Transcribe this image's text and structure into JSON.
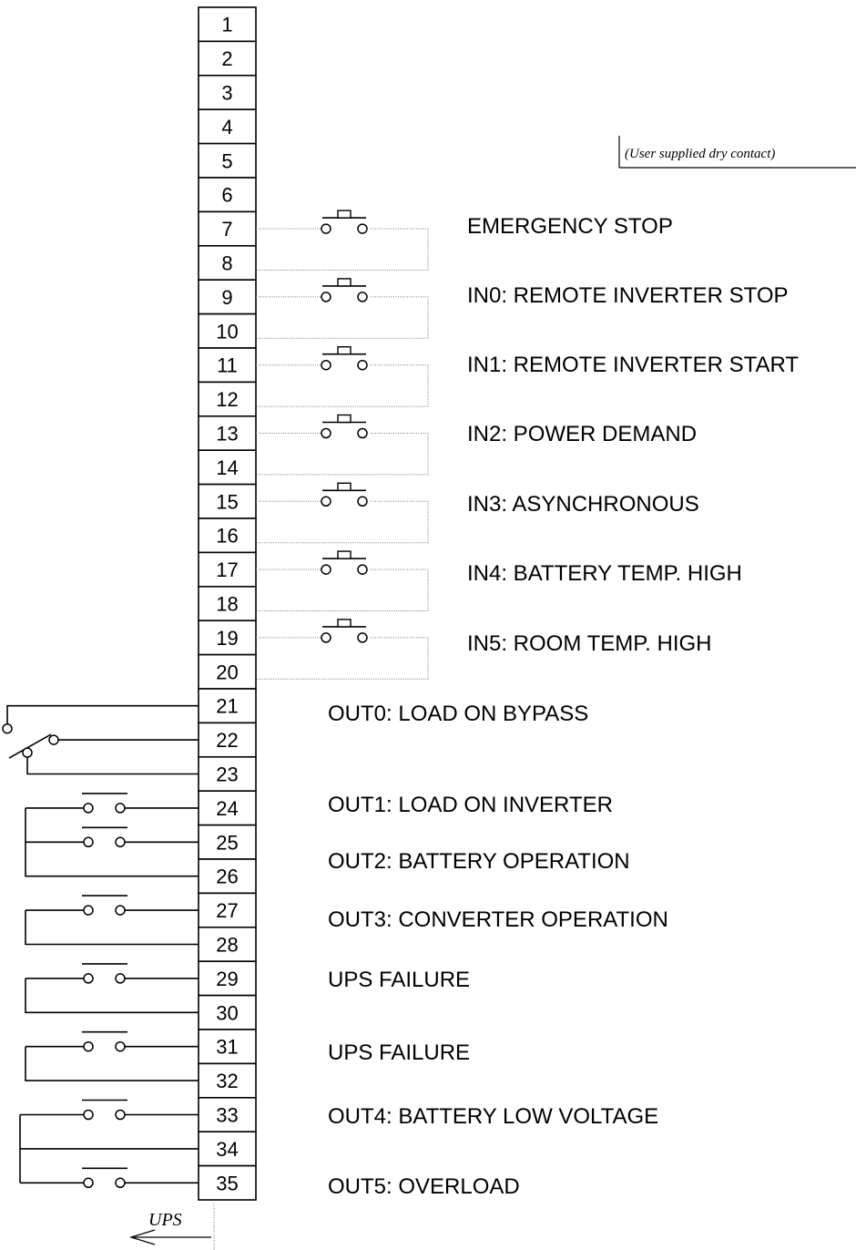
{
  "terminals": [
    "1",
    "2",
    "3",
    "4",
    "5",
    "6",
    "7",
    "8",
    "9",
    "10",
    "11",
    "12",
    "13",
    "14",
    "15",
    "16",
    "17",
    "18",
    "19",
    "20",
    "21",
    "22",
    "23",
    "24",
    "25",
    "26",
    "27",
    "28",
    "29",
    "30",
    "31",
    "32",
    "33",
    "34",
    "35"
  ],
  "note": "(User supplied dry contact)",
  "inputs": [
    {
      "label": "EMERGENCY STOP"
    },
    {
      "label": "IN0: REMOTE INVERTER STOP"
    },
    {
      "label": "IN1: REMOTE INVERTER START"
    },
    {
      "label": "IN2: POWER DEMAND"
    },
    {
      "label": "IN3: ASYNCHRONOUS"
    },
    {
      "label": "IN4: BATTERY TEMP. HIGH"
    },
    {
      "label": "IN5: ROOM TEMP. HIGH"
    }
  ],
  "outputs": [
    {
      "label": "OUT0: LOAD ON BYPASS"
    },
    {
      "label": "OUT1: LOAD ON INVERTER"
    },
    {
      "label": "OUT2: BATTERY OPERATION"
    },
    {
      "label": "OUT3: CONVERTER OPERATION"
    },
    {
      "label": "UPS FAILURE"
    },
    {
      "label": "UPS FAILURE"
    },
    {
      "label": "OUT4: BATTERY LOW VOLTAGE"
    },
    {
      "label": "OUT5: OVERLOAD"
    }
  ],
  "ups_label": "UPS"
}
